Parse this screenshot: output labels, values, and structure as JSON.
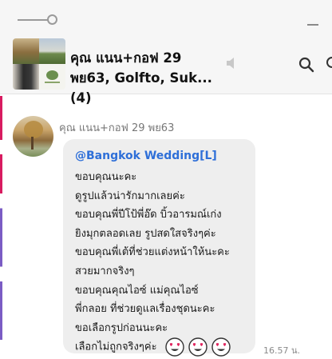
{
  "header": {
    "title_line1": "คุณ แนน+กอฟ 29",
    "title_line2": "พย63, Golfto, Suk... (4)"
  },
  "message": {
    "sender": "คุณ แนน+กอฟ 29 พย63",
    "mention": "@Bangkok Wedding[L]",
    "lines": [
      "ขอบคุณนะคะ",
      "ดูรูปแล้วน่ารักมากเลยค่ะ",
      "ขอบคุณพี่ปีโป้พี่อ๊ด บิ้วอารมณ์เก่ง",
      "ยิงมุกตลอดเลย รูปสดใสจริงๆค่ะ",
      "ขอบคุณพี่เต้ที่ช่วยแต่งหน้าให้นะคะ",
      "สวยมากจริงๆ",
      "ขอบคุณคุณไอซ์ แม่คุณไอซ์",
      "พี่กลอย ที่ช่วยดูแลเรื่องชุดนะคะ",
      "ขอเลือกรูปก่อนนะคะ",
      "เลือกไม่ถูกจริงๆค่ะ"
    ],
    "emoji": "heart-eyes-emoji",
    "time": "16.57 น."
  },
  "colors": {
    "mention": "#2e6fd8",
    "bubble": "#eeeeee",
    "accent_stripe": "#d81b60"
  }
}
